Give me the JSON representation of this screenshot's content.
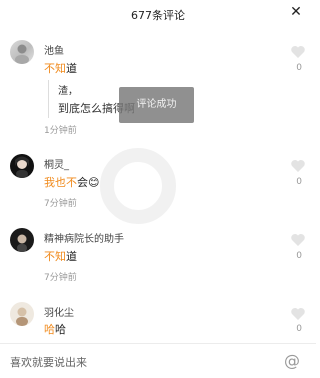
{
  "header": {
    "title": "677条评论",
    "close_icon": "close-icon"
  },
  "toast": {
    "text": "评论成功"
  },
  "comments": [
    {
      "name": "池鱼",
      "text_highlight": "不知",
      "text_rest": "道",
      "reply_lines": [
        "渣，",
        "到底怎么搞得啊"
      ],
      "time": "1分钟前",
      "likes": "0"
    },
    {
      "name": "桐灵_",
      "text_highlight": "我也不",
      "text_rest": "会😊",
      "time": "7分钟前",
      "likes": "0"
    },
    {
      "name": "精神病院长的助手",
      "text_highlight": "不知",
      "text_rest": "道",
      "time": "7分钟前",
      "likes": "0"
    },
    {
      "name": "羽化尘",
      "text_highlight": "哈",
      "text_rest": "哈",
      "likes": "0"
    }
  ],
  "footer": {
    "placeholder": "喜欢就要说出来",
    "at_icon": "at-icon"
  },
  "colors": {
    "highlight": "#f08a1c",
    "muted": "#999999"
  }
}
